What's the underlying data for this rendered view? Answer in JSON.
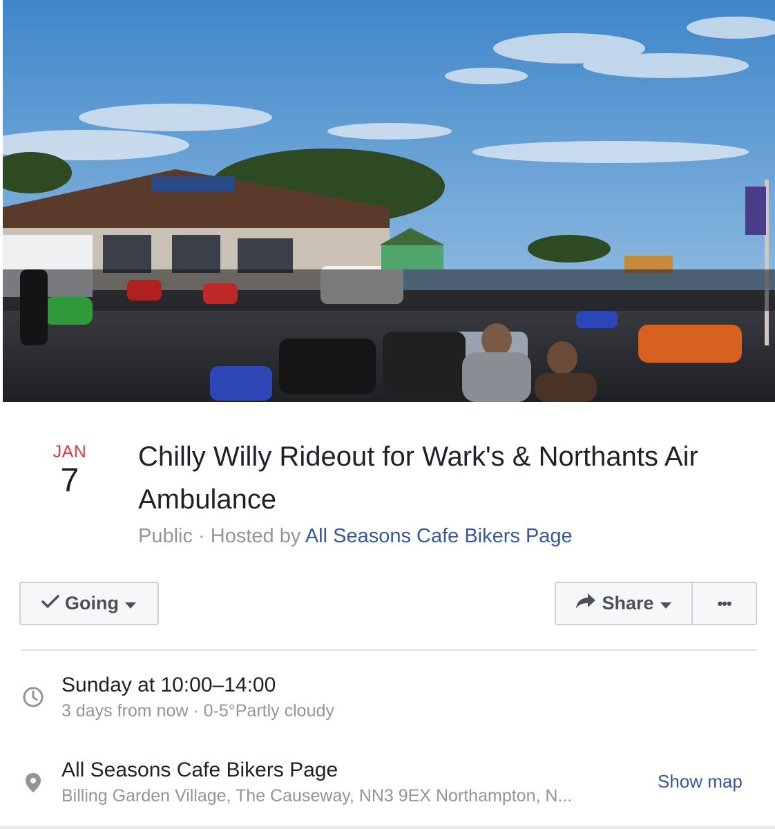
{
  "event": {
    "cover_alt": "Event cover photo: motorcycles and riders gathered in a car park in front of a cafe building",
    "date_month": "JAN",
    "date_day": "7",
    "title": "Chilly Willy Rideout for Wark's & Northants Air Ambulance",
    "privacy": "Public",
    "hosted_by_prefix": " · Hosted by ",
    "host_name": "All Seasons Cafe Bikers Page"
  },
  "actions": {
    "going_label": "Going",
    "share_label": "Share",
    "more_label": "•••"
  },
  "details": {
    "time_main": "Sunday at 10:00–14:00",
    "time_sub": "3 days from now · 0-5°Partly cloudy",
    "location_name": "All Seasons Cafe Bikers Page",
    "location_address": "Billing Garden Village, The Causeway, NN3 9EX Northampton, N...",
    "show_map_label": "Show map"
  },
  "icons": {
    "going_check": "check-icon",
    "going_caret": "caret-down-icon",
    "share_arrow": "share-arrow-icon",
    "share_caret": "caret-down-icon",
    "clock": "clock-icon",
    "pin": "location-pin-icon"
  },
  "colors": {
    "accent_red": "#e0393e",
    "link_blue": "#365899",
    "muted_text": "#90949c",
    "button_bg": "#f6f7f9"
  }
}
